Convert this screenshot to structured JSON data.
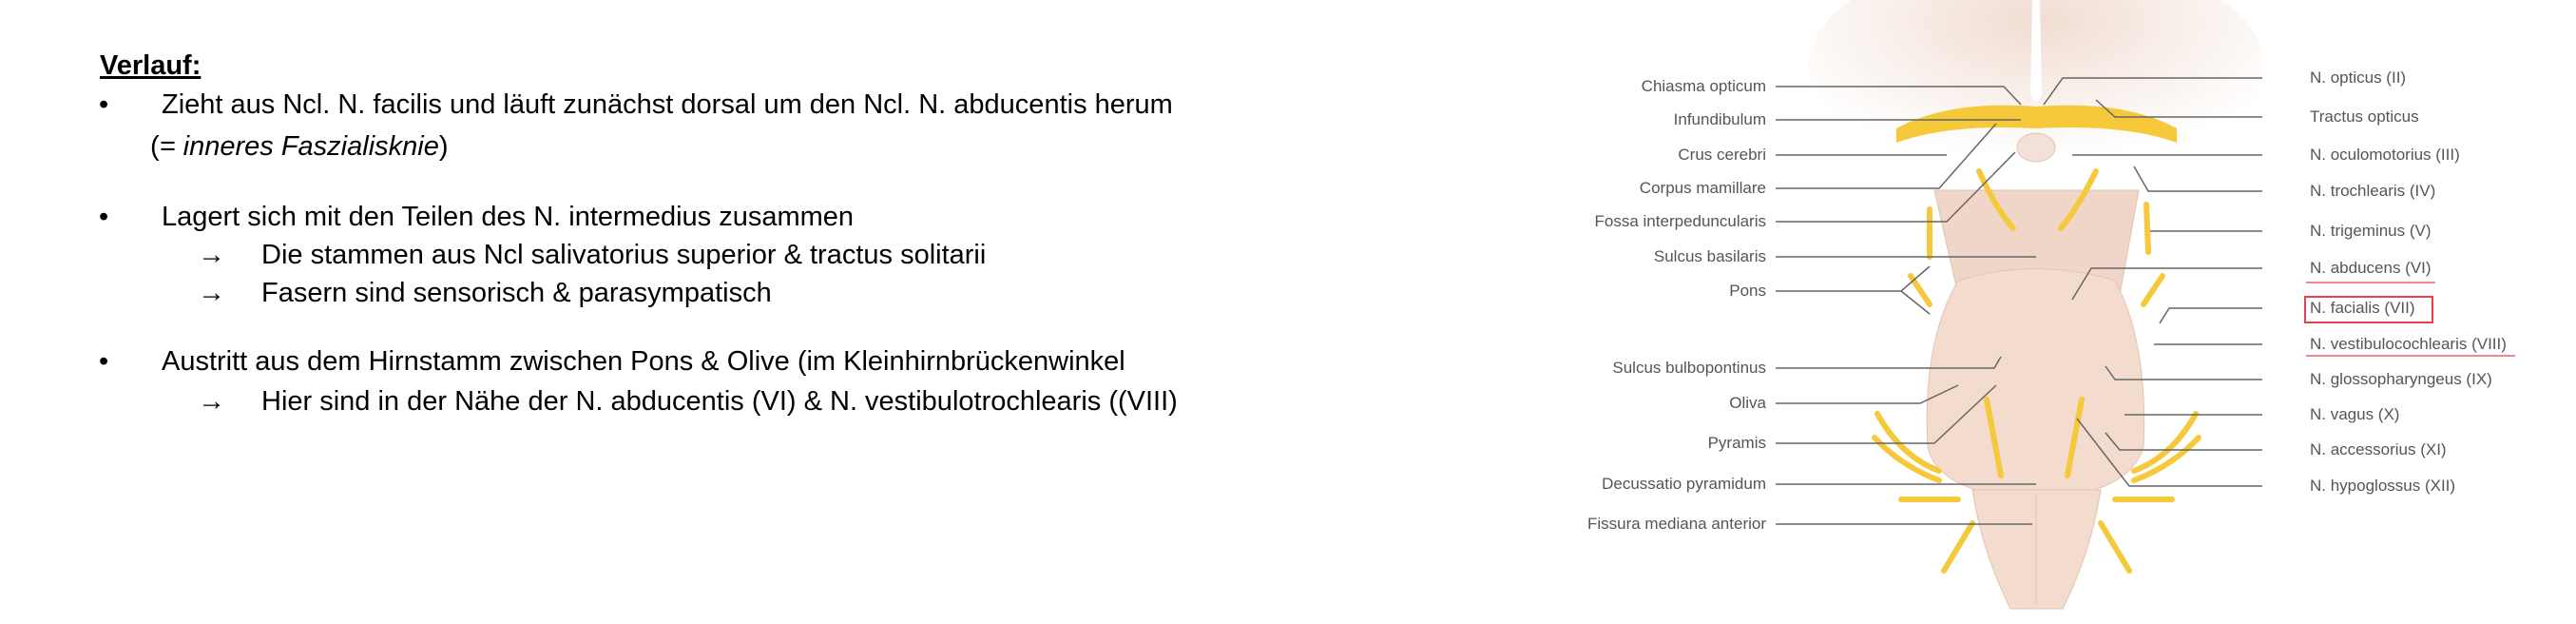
{
  "slide": {
    "title": "Verlauf:",
    "bullet_symbol": "•",
    "arrow_symbol": "→",
    "items": [
      {
        "text": "Zieht aus Ncl. N. facilis und läuft zunächst dorsal um den Ncl. N. abducentis herum",
        "note": "(= inneres Faszialisknie)",
        "note_italic": "= inneres Faszialisknie",
        "subitems": []
      },
      {
        "text": "Lagert sich mit den Teilen des N. intermedius zusammen",
        "subitems": [
          "Die stammen aus Ncl salivatorius superior & tractus solitarii",
          "Fasern sind sensorisch & parasympatisch"
        ]
      },
      {
        "text": "Austritt aus dem Hirnstamm zwischen Pons & Olive (im Kleinhirnbrückenwinkel",
        "subitems": [
          "Hier sind in der Nähe der N. abducentis (VI) & N. vestibulotrochlearis ((VIII)"
        ]
      }
    ]
  },
  "figure": {
    "left_labels": [
      "Chiasma opticum",
      "Infundibulum",
      "Crus cerebri",
      "Corpus mamillare",
      "Fossa interpeduncularis",
      "Sulcus basilaris",
      "Pons",
      "Sulcus bulbopontinus",
      "Oliva",
      "Pyramis",
      "Decussatio pyramidum",
      "Fissura mediana anterior"
    ],
    "right_labels": [
      "N. opticus (II)",
      "Tractus opticus",
      "N. oculomotorius (III)",
      "N. trochlearis (IV)",
      "N. trigeminus (V)",
      "N. abducens (VI)",
      "N. facialis (VII)",
      "N. vestibulocochlearis (VIII)",
      "N. glossopharyngeus (IX)",
      "N. vagus (X)",
      "N. accessorius (XI)",
      "N. hypoglossus (XII)"
    ],
    "highlight_box": "N. facialis (VII)",
    "underlined": [
      "N. abducens (VI)",
      "N. vestibulocochlearis (VIII)"
    ],
    "colors": {
      "nerve": "#f5c93a",
      "tissue": "#f3dccd",
      "highlight": "#e8404a"
    }
  }
}
